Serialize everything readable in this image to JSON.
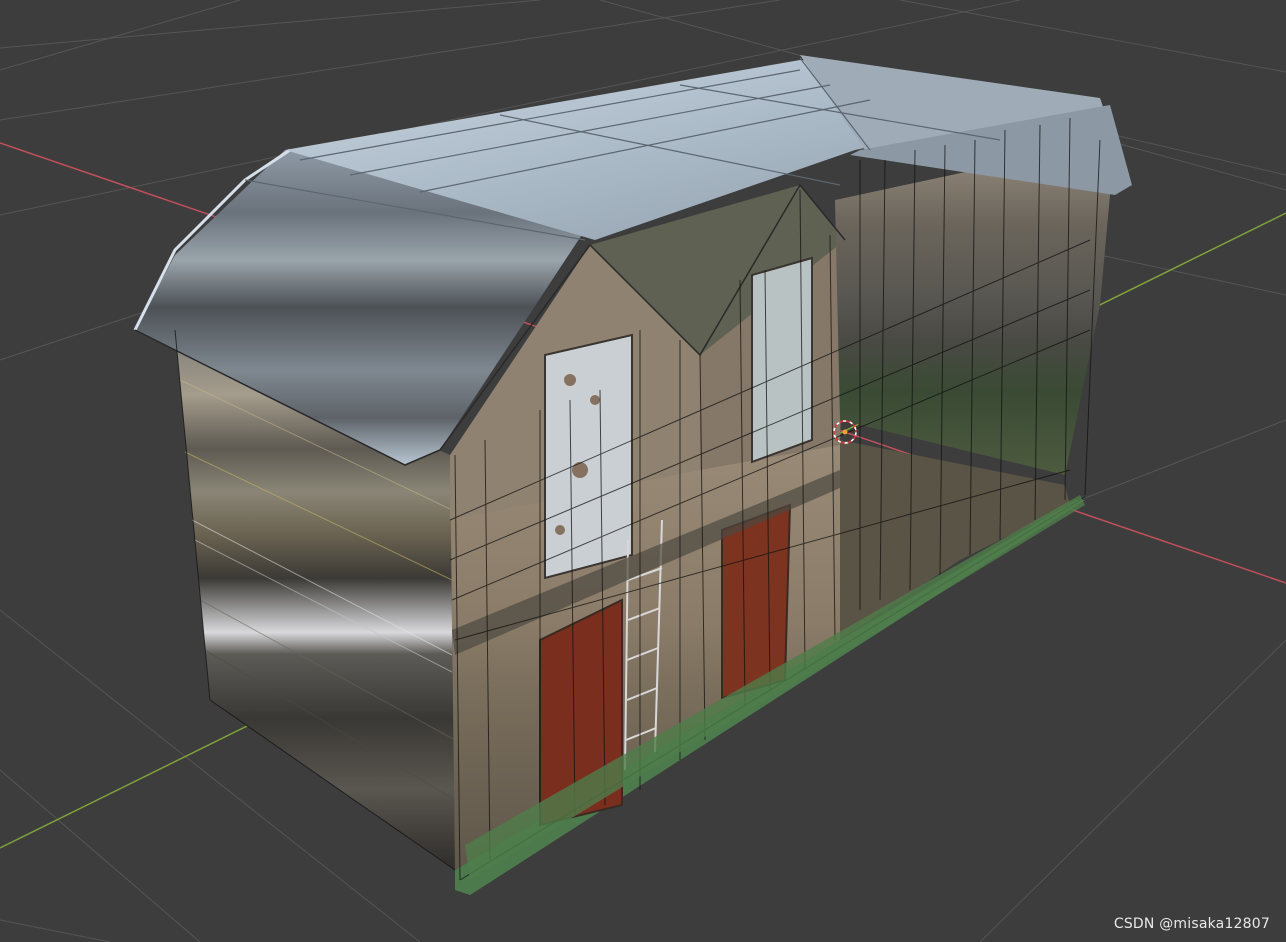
{
  "app": "3D viewport",
  "viewport": {
    "background": "#3d3d3d",
    "grid_color": "#555555",
    "x_axis_color": "#c0505a",
    "y_axis_color": "#7ea23c"
  },
  "object": {
    "type": "textured building model",
    "wireframe_overlay": true
  },
  "icons": {
    "origin": "3d-cursor-icon"
  },
  "watermark": "CSDN @misaka12807"
}
